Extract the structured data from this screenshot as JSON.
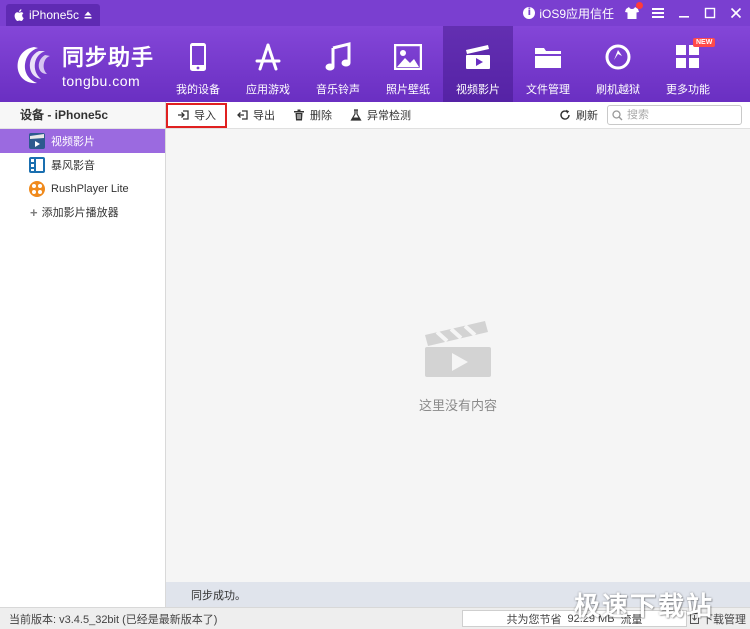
{
  "titlebar": {
    "device_tab": "iPhone5c",
    "trust_label": "iOS9应用信任"
  },
  "header": {
    "logo_cn": "同步助手",
    "logo_en": "tongbu.com",
    "nav": [
      {
        "label": "我的设备",
        "icon": "phone-icon"
      },
      {
        "label": "应用游戏",
        "icon": "app-store-icon"
      },
      {
        "label": "音乐铃声",
        "icon": "music-note-icon"
      },
      {
        "label": "照片壁纸",
        "icon": "picture-icon"
      },
      {
        "label": "视频影片",
        "icon": "clapperboard-icon"
      },
      {
        "label": "文件管理",
        "icon": "folder-icon"
      },
      {
        "label": "刷机越狱",
        "icon": "refresh-circle-icon"
      },
      {
        "label": "更多功能",
        "icon": "grid-icon"
      }
    ],
    "new_badge": "NEW",
    "active_nav": "视频影片"
  },
  "sidebar": {
    "title": "设备 - iPhone5c",
    "items": [
      {
        "label": "视频影片",
        "icon": "video-icon"
      },
      {
        "label": "暴风影音",
        "icon": "baofeng-icon"
      },
      {
        "label": "RushPlayer Lite",
        "icon": "rushplayer-icon"
      }
    ],
    "add_label": "添加影片播放器"
  },
  "toolbar": {
    "import": "导入",
    "export": "导出",
    "delete": "删除",
    "check": "异常检测",
    "refresh": "刷新",
    "search_placeholder": "搜索"
  },
  "content": {
    "empty_text": "这里没有内容",
    "status": "同步成功。"
  },
  "footer": {
    "version": "当前版本: v3.4.5_32bit  (已经是最新版本了)",
    "traffic_label": "共为您节省",
    "traffic_value": "92.29 MB",
    "traffic_unit": "流量",
    "download": "下载管理"
  },
  "watermark": "极速下载站",
  "colors": {
    "brand_purple": "#7a3fd0",
    "active_item": "#9b6ae0",
    "highlight_red": "#e02020"
  }
}
